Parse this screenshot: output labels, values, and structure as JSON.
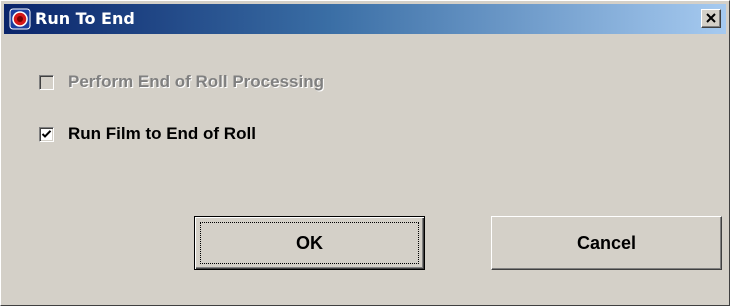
{
  "window": {
    "title": "Run To End",
    "app_icon": "camera-app-icon",
    "close_icon": "close-icon"
  },
  "options": [
    {
      "label": "Perform End of Roll Processing",
      "checked": false,
      "enabled": false
    },
    {
      "label": "Run Film to End of Roll",
      "checked": true,
      "enabled": true
    }
  ],
  "buttons": {
    "ok_label": "OK",
    "cancel_label": "Cancel"
  },
  "colors": {
    "titlebar_start": "#0a246a",
    "titlebar_end": "#a6caf0",
    "dialog_face": "#d4d0c8",
    "disabled_text": "#808080"
  }
}
